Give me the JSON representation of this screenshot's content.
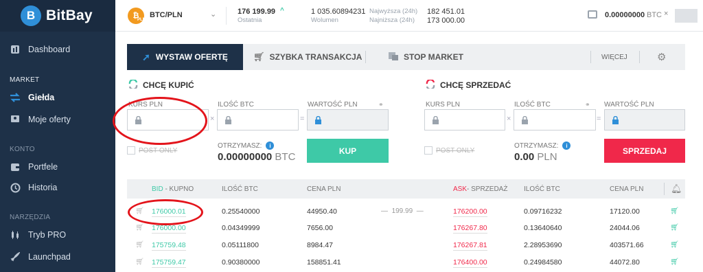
{
  "app": {
    "name": "BitBay",
    "logo_letter": "B"
  },
  "sidebar": {
    "dashboard": "Dashboard",
    "section_market": "MARKET",
    "gielda": "Giełda",
    "moje_oferty": "Moje oferty",
    "section_konto": "KONTO",
    "portfele": "Portfele",
    "historia": "Historia",
    "section_narzedzia": "NARZĘDZIA",
    "tryb_pro": "Tryb PRO",
    "launchpad": "Launchpad"
  },
  "topbar": {
    "coin_label": "PLN",
    "pair": "BTC/PLN",
    "last_value": "176 199.99",
    "last_label": "Ostatnia",
    "volume_value": "1 035.60894231",
    "volume_label": "Wolumen",
    "high_label": "Najwyższa (24h)",
    "high_value": "182 451.01",
    "low_label": "Najniższa (24h)",
    "low_value": "173 000.00",
    "balance": "0.00000000",
    "balance_currency": "BTC"
  },
  "tabs": {
    "wystaw": "WYSTAW OFERTĘ",
    "szybka": "SZYBKA TRANSAKCJA",
    "stop": "STOP MARKET",
    "wiecej": "WIĘCEJ"
  },
  "buy": {
    "title": "CHCĘ KUPIĆ",
    "kurs_label": "KURS PLN",
    "ilosc_label": "ILOŚĆ BTC",
    "wartosc_label": "WARTOŚĆ PLN",
    "post_only": "POST ONLY",
    "otrzymasz_label": "OTRZYMASZ:",
    "otrzymasz_value": "0.00000000",
    "otrzymasz_unit": "BTC",
    "button": "KUP"
  },
  "sell": {
    "title": "CHCĘ SPRZEDAĆ",
    "kurs_label": "KURS PLN",
    "ilosc_label": "ILOŚĆ BTC",
    "wartosc_label": "WARTOŚĆ PLN",
    "post_only": "POST ONLY",
    "otrzymasz_label": "OTRZYMASZ:",
    "otrzymasz_value": "0.00",
    "otrzymasz_unit": "PLN",
    "button": "SPRZEDAJ"
  },
  "orderbook": {
    "bid_label": "BID",
    "bid_suffix": " - KUPNO",
    "ilosc_btc": "ILOŚĆ BTC",
    "cena_pln": "CENA PLN",
    "ask_label": "ASK",
    "ask_suffix": "- SPRZEDAŻ",
    "spread": "199.99",
    "rows": [
      {
        "bid": "176000.01",
        "bid_qty": "0.25540000",
        "bid_total": "44950.40",
        "ask": "176200.00",
        "ask_qty": "0.09716232",
        "ask_total": "17120.00"
      },
      {
        "bid": "176000.00",
        "bid_qty": "0.04349999",
        "bid_total": "7656.00",
        "ask": "176267.80",
        "ask_qty": "0.13640640",
        "ask_total": "24044.06"
      },
      {
        "bid": "175759.48",
        "bid_qty": "0.05111800",
        "bid_total": "8984.47",
        "ask": "176267.81",
        "ask_qty": "2.28953690",
        "ask_total": "403571.66"
      },
      {
        "bid": "175759.47",
        "bid_qty": "0.90380000",
        "bid_total": "158851.41",
        "ask": "176400.00",
        "ask_qty": "0.24984580",
        "ask_total": "44072.80"
      }
    ]
  },
  "colors": {
    "sidebar": "#1e3148",
    "green": "#3ec9a7",
    "red": "#f0284a",
    "annotation": "#e3141b"
  }
}
